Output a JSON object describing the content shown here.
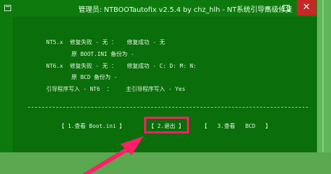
{
  "window": {
    "title": "管理员: NTBOOTautofix v2.5.4 by chz_hlh - NT系统引导高级修复",
    "controls": {
      "minimize": "—",
      "maximize": "□",
      "close": "✕"
    }
  },
  "console": {
    "nt5_line1": "NT5.x  修复失败 - 无 ：   修复成功 - 无",
    "nt5_line2": "原 BOOT.INI 备份为 -",
    "nt6_line1": "NT6.x  修复失败 - 无 ：   修复成功 - C: D: M: N:",
    "nt6_line2": "原 BCD 备份为 -",
    "loader_line": "引导程序写入 - NT6  ：    主引导程序写入 - Yes"
  },
  "menu": {
    "view_bootini": "【 1.查看 Boot.ini 】",
    "exit": "【 2.退出 】",
    "view_bcd": "【   3.查看   BCD   】"
  },
  "colors": {
    "console_bg": "#0a6e0a",
    "highlight": "#ff1f6a"
  }
}
